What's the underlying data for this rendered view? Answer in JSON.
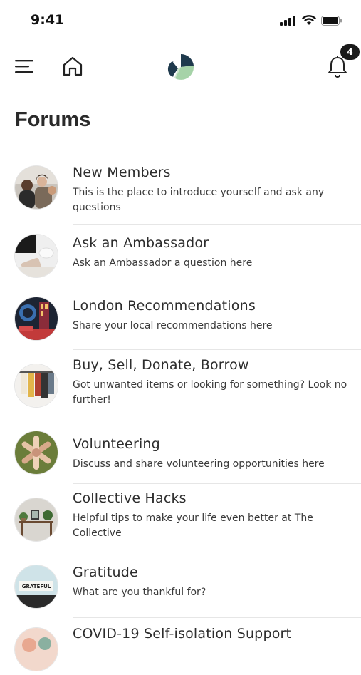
{
  "status_bar": {
    "time": "9:41"
  },
  "nav": {
    "notification_count": "4"
  },
  "page": {
    "title": "Forums"
  },
  "forums": [
    {
      "title": "New Members",
      "description": "This is the place to introduce yourself and ask any questions"
    },
    {
      "title": "Ask an Ambassador",
      "description": "Ask an Ambassador a question here"
    },
    {
      "title": "London Recommendations",
      "description": "Share your local recommendations here"
    },
    {
      "title": "Buy, Sell, Donate, Borrow",
      "description": "Got unwanted items or looking for something? Look no further!"
    },
    {
      "title": "Volunteering",
      "description": "Discuss and share volunteering opportunities here"
    },
    {
      "title": "Collective Hacks",
      "description": "Helpful tips to make your life even better at The Collective"
    },
    {
      "title": "Gratitude",
      "description": "What are you thankful for?",
      "avatar_text": "GRATEFUL"
    },
    {
      "title": "COVID-19 Self-isolation Support",
      "description": ""
    }
  ],
  "colors": {
    "badge_bg": "#1a1a1a",
    "logo_dark": "#1f3a4d",
    "logo_green": "#a6d3a8"
  }
}
